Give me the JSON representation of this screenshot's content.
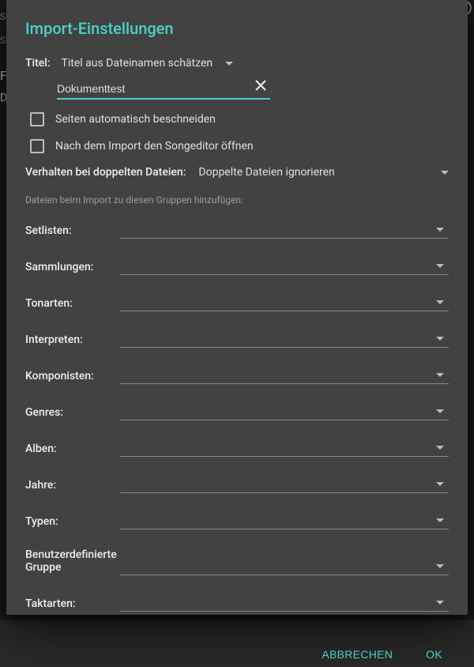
{
  "bg": {
    "su": "Su",
    "sa": "Sa",
    "f": "F",
    "d": "D"
  },
  "dialog": {
    "title": "Import-Einstellungen",
    "titleField": {
      "label": "Titel:",
      "modeSelected": "Titel aus Dateinamen schätzen",
      "inputValue": "Dokumenttest"
    },
    "checkboxes": {
      "autoCrop": "Seiten automatisch beschneiden",
      "openEditor": "Nach dem Import den Songeditor öffnen"
    },
    "duplicates": {
      "label": "Verhalten bei doppelten Dateien:",
      "selected": "Doppelte Dateien ignorieren"
    },
    "helper": "Dateien beim Import zu diesen Gruppen hinzufügen:",
    "fields": [
      {
        "label": "Setlisten:"
      },
      {
        "label": "Sammlungen:"
      },
      {
        "label": "Tonarten:"
      },
      {
        "label": "Interpreten:"
      },
      {
        "label": "Komponisten:"
      },
      {
        "label": "Genres:"
      },
      {
        "label": "Alben:"
      },
      {
        "label": "Jahre:"
      },
      {
        "label": "Typen:"
      },
      {
        "label": "Benutzerdefinierte Gruppe"
      },
      {
        "label": "Taktarten:"
      }
    ],
    "actions": {
      "cancel": "ABBRECHEN",
      "ok": "OK"
    }
  }
}
